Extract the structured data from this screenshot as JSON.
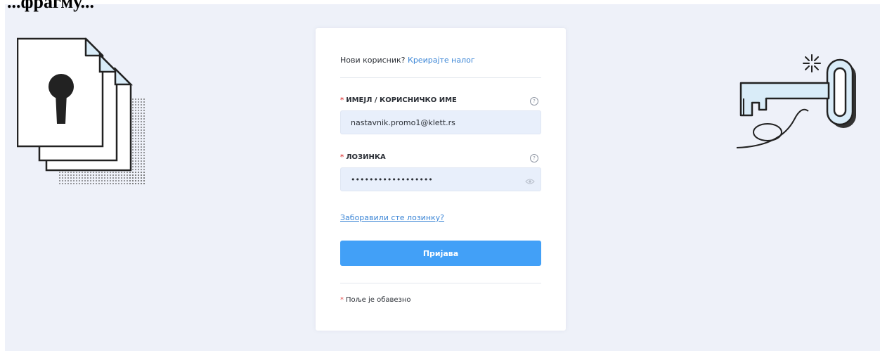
{
  "header": {
    "partial_title": "...фрагму..."
  },
  "form": {
    "new_user_text": "Нови корисник?",
    "create_account_link": "Креирајте налог",
    "email_label": "ИМЕЈЛ / КОРИСНИЧКО ИМЕ",
    "email_value": "nastavnik.promo1@klett.rs",
    "password_label": "ЛОЗИНКА",
    "password_value": "••••••••••••••••••",
    "forgot_password_link": "Заборавили сте лозинку?",
    "login_button": "Пријава",
    "required_marker": "*",
    "required_note": "Поље је обавезно",
    "help_glyph": "?"
  },
  "icons": {
    "left_illustration": "locked-documents-icon",
    "right_illustration": "key-icon",
    "help": "question-circle-icon",
    "password_visibility": "eye-icon"
  },
  "colors": {
    "page_bg": "#eef1f9",
    "input_bg": "#e8effb",
    "primary_button": "#42a0f7",
    "link": "#3c86d6",
    "required": "#e14c4c",
    "illustration_accent": "#d9ecf8"
  }
}
